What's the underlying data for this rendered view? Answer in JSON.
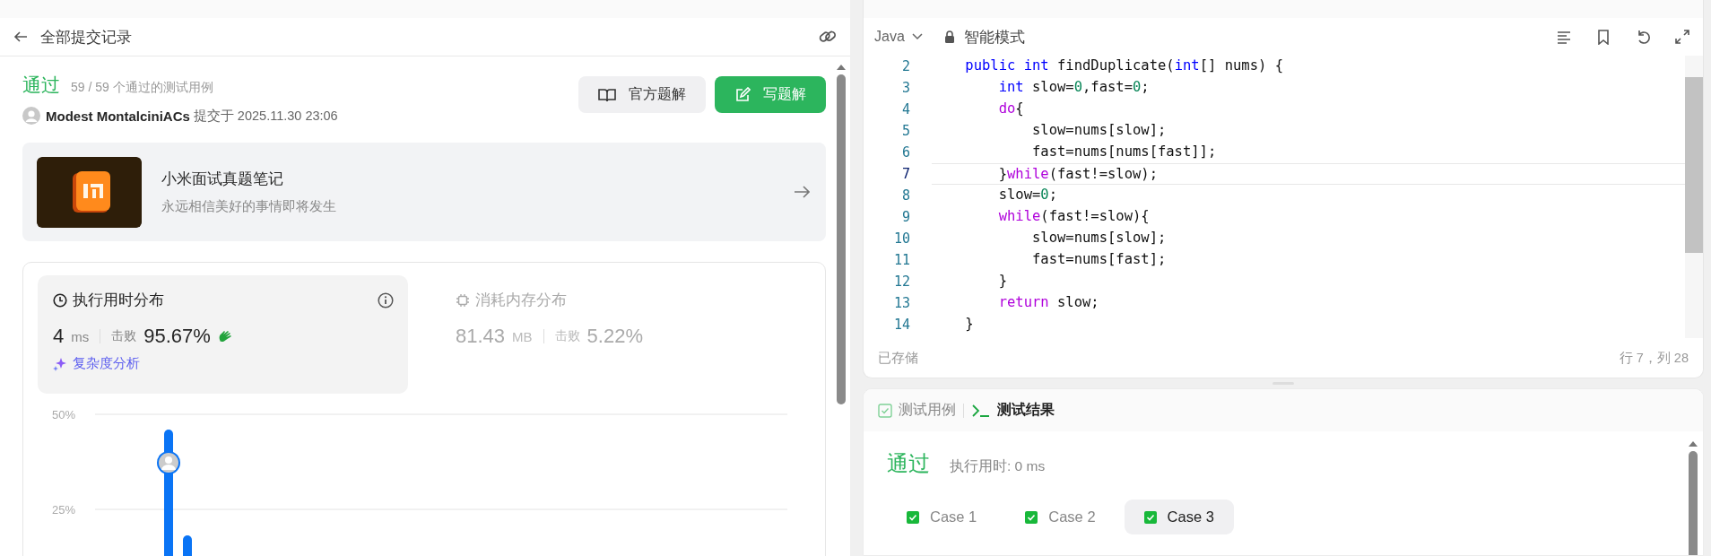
{
  "submission_panel": {
    "title": "全部提交记录",
    "result": {
      "status": "通过",
      "testcases": "59 / 59 个通过的测试用例",
      "user": "Modest MontalciniACs",
      "submitted": "提交于 2025.11.30 23:06"
    },
    "buttons": [
      {
        "label": "官方题解",
        "kind": "secondary"
      },
      {
        "label": "写题解",
        "kind": "primary"
      }
    ],
    "promo": {
      "title": "小米面试真题笔记",
      "subtitle": "永远相信美好的事情即将发生"
    },
    "stats": [
      {
        "kind": "runtime",
        "title": "执行用时分布",
        "value": "4",
        "unit": "ms",
        "beat_label": "击败",
        "beat": "95.67%",
        "selected": true,
        "link": "复杂度分析"
      },
      {
        "kind": "memory",
        "title": "消耗内存分布",
        "value": "81.43",
        "unit": "MB",
        "beat_label": "击败",
        "beat": "5.22%",
        "selected": false
      }
    ],
    "chart_axis_labels": [
      "50%",
      "25%"
    ]
  },
  "editor": {
    "language": "Java",
    "mode": "智能模式",
    "lines": [
      {
        "number": "2",
        "current": false,
        "tokens": [
          {
            "text": "    public int",
            "kind": "type"
          },
          {
            "text": " findDuplicate("
          },
          {
            "text": "int",
            "kind": "type"
          },
          {
            "text": "[] nums) {"
          }
        ]
      },
      {
        "number": "3",
        "current": false,
        "tokens": [
          {
            "text": "        int",
            "kind": "type"
          },
          {
            "text": " slow="
          },
          {
            "text": "0",
            "kind": "number"
          },
          {
            "text": ",fast="
          },
          {
            "text": "0",
            "kind": "number"
          },
          {
            "text": ";"
          }
        ]
      },
      {
        "number": "4",
        "current": false,
        "tokens": [
          {
            "text": "        do",
            "kind": "control"
          },
          {
            "text": "{"
          }
        ]
      },
      {
        "number": "5",
        "current": false,
        "tokens": [
          {
            "text": "            slow=nums[slow];"
          }
        ]
      },
      {
        "number": "6",
        "current": false,
        "tokens": [
          {
            "text": "            fast=nums[nums[fast]];"
          }
        ]
      },
      {
        "number": "7",
        "current": true,
        "tokens": [
          {
            "text": "        }"
          },
          {
            "text": "while",
            "kind": "control"
          },
          {
            "text": "(fast!=slow);"
          }
        ]
      },
      {
        "number": "8",
        "current": false,
        "tokens": [
          {
            "text": "        slow="
          },
          {
            "text": "0",
            "kind": "number"
          },
          {
            "text": ";"
          }
        ]
      },
      {
        "number": "9",
        "current": false,
        "tokens": [
          {
            "text": "        while",
            "kind": "control"
          },
          {
            "text": "(fast!=slow){"
          }
        ]
      },
      {
        "number": "10",
        "current": false,
        "tokens": [
          {
            "text": "            slow=nums[slow];"
          }
        ]
      },
      {
        "number": "11",
        "current": false,
        "tokens": [
          {
            "text": "            fast=nums[fast];"
          }
        ]
      },
      {
        "number": "12",
        "current": false,
        "tokens": [
          {
            "text": "        }"
          }
        ]
      },
      {
        "number": "13",
        "current": false,
        "tokens": [
          {
            "text": "        return",
            "kind": "control"
          },
          {
            "text": " slow;"
          }
        ]
      },
      {
        "number": "14",
        "current": false,
        "tokens": [
          {
            "text": "    }"
          }
        ]
      }
    ],
    "save_status": "已存储",
    "cursor": "行 7，列 28"
  },
  "results_panel": {
    "tabs": [
      {
        "label": "测试用例",
        "kind": "testcase",
        "selected": false
      },
      {
        "label": "测试结果",
        "kind": "result",
        "selected": true
      }
    ],
    "status": "通过",
    "runtime": "执行用时: 0 ms",
    "cases": [
      {
        "label": "Case 1",
        "passed": true,
        "selected": false
      },
      {
        "label": "Case 2",
        "passed": true,
        "selected": false
      },
      {
        "label": "Case 3",
        "passed": true,
        "selected": true
      }
    ]
  }
}
